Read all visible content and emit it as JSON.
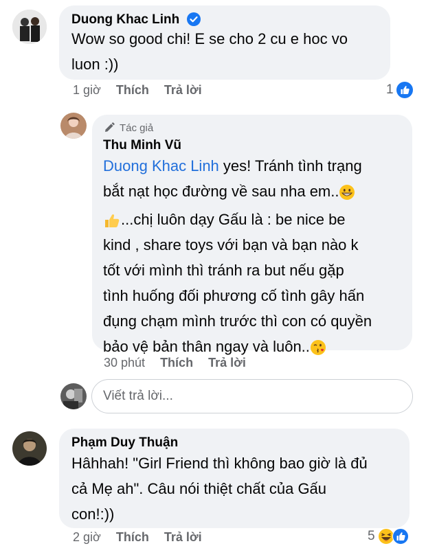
{
  "comments": [
    {
      "author": "Duong Khac Linh",
      "verified": true,
      "text_lines": [
        "Wow so good chi! E se cho 2 cu e hoc vo",
        "luon :))"
      ],
      "time": "1 giờ",
      "like_label": "Thích",
      "reply_label": "Trả lời",
      "reaction_count": "1",
      "reactions": [
        "like-icon"
      ]
    },
    {
      "author_badge": "Tác giả",
      "author": "Thu Minh Vũ",
      "mention": "Duong Khac Linh",
      "text_line1_rest": " yes! Tránh tình trạng",
      "text_line2": "bắt nạt học đường về sau nha em..",
      "para2_line1": "...chị luôn dạy Gấu là : be nice be",
      "para2_line2": "kind , share toys với bạn và bạn nào k",
      "para2_line3": "tốt với mình thì tránh ra but nếu gặp",
      "para2_line4": "tình huống đối phương cố tình gây hấn",
      "para2_line5": "đụng chạm mình trước thì con có quyền",
      "para2_line6": "bảo vệ bản thân ngay và luôn..",
      "time": "30 phút",
      "like_label": "Thích",
      "reply_label": "Trả lời"
    },
    {
      "author": "Phạm Duy Thuận",
      "text_lines": [
        "Hâhhah! \"Girl Friend thì không bao giờ là đủ",
        "cả Mẹ ah\". Câu nói thiệt chất của Gấu",
        "con!:))"
      ],
      "time": "2 giờ",
      "like_label": "Thích",
      "reply_label": "Trả lời",
      "reaction_count": "5",
      "reactions": [
        "haha-icon",
        "like-icon"
      ]
    }
  ],
  "reply_box": {
    "placeholder": "Viết trả lời..."
  },
  "colors": {
    "bubble": "#f0f2f5",
    "mention": "#216fdb",
    "meta": "#65676b",
    "like_blue": "#1877f2"
  }
}
